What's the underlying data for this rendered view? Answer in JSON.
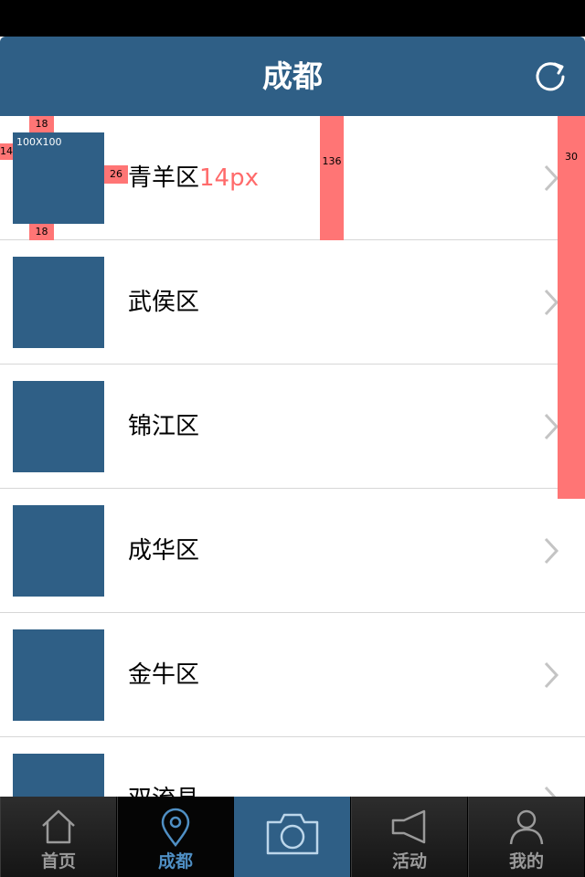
{
  "header": {
    "title": "成都"
  },
  "list": {
    "items": [
      {
        "label": "青羊区"
      },
      {
        "label": "武侯区"
      },
      {
        "label": "锦江区"
      },
      {
        "label": "成华区"
      },
      {
        "label": "金牛区"
      },
      {
        "label": "双流县"
      }
    ]
  },
  "annotations": {
    "top_gap": "18",
    "bottom_gap": "18",
    "left_gap": "14",
    "thumb_size": "100X100",
    "label_gap": "26",
    "font_size": "14px",
    "row_height": "136",
    "right_gap": "30"
  },
  "tabbar": {
    "tabs": [
      {
        "label": "首页",
        "icon": "home-icon"
      },
      {
        "label": "成都",
        "icon": "location-pin-icon",
        "active": true
      },
      {
        "label": "",
        "icon": "camera-icon"
      },
      {
        "label": "活动",
        "icon": "megaphone-icon"
      },
      {
        "label": "我的",
        "icon": "user-icon"
      }
    ]
  },
  "colors": {
    "primary": "#2f5f86",
    "annotation": "#ff7575",
    "active_tab_text": "#4f8fc4"
  }
}
